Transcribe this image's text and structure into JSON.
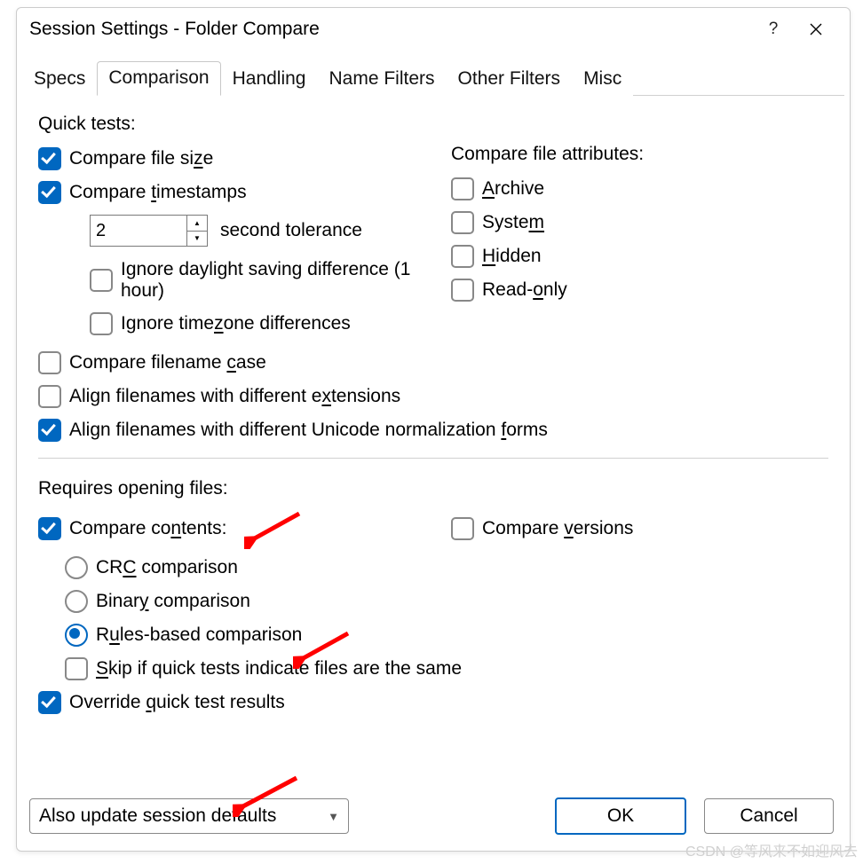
{
  "window": {
    "title": "Session Settings - Folder Compare",
    "help_label": "?",
    "close_label": "×"
  },
  "tabs": {
    "specs": "Specs",
    "comparison": "Comparison",
    "handling": "Handling",
    "name_filters": "Name Filters",
    "other_filters": "Other Filters",
    "misc": "Misc"
  },
  "quick_tests": {
    "heading": "Quick tests:",
    "compare_file_size": {
      "pre": "Compare file si",
      "u": "z",
      "post": "e",
      "checked": true
    },
    "compare_timestamps": {
      "pre": "Compare ",
      "u": "t",
      "post": "imestamps",
      "checked": true
    },
    "tolerance_value": "2",
    "tolerance_suffix": "second tolerance",
    "ignore_dst": {
      "pre": "Ignore daylight saving difference (1 hour)",
      "u": "",
      "post": "",
      "checked": false
    },
    "ignore_tz": {
      "pre": "Ignore time",
      "u": "z",
      "post": "one differences",
      "checked": false
    },
    "compare_case": {
      "pre": "Compare filename ",
      "u": "c",
      "post": "ase",
      "checked": false
    },
    "align_ext": {
      "pre": "Align filenames with different e",
      "u": "x",
      "post": "tensions",
      "checked": false
    },
    "align_unicode": {
      "pre": "Align filenames with different Unicode normalization ",
      "u": "f",
      "post": "orms",
      "checked": true
    }
  },
  "attributes": {
    "heading": "Compare file attributes:",
    "archive": {
      "pre": "",
      "u": "A",
      "post": "rchive",
      "checked": false
    },
    "system": {
      "pre": "Syste",
      "u": "m",
      "post": "",
      "checked": false
    },
    "hidden": {
      "pre": "",
      "u": "H",
      "post": "idden",
      "checked": false
    },
    "readonly": {
      "pre": "Read-",
      "u": "o",
      "post": "nly",
      "checked": false
    }
  },
  "requires": {
    "heading": "Requires opening files:",
    "compare_contents": {
      "pre": "Compare co",
      "u": "n",
      "post": "tents:",
      "checked": true
    },
    "compare_versions": {
      "pre": "Compare ",
      "u": "v",
      "post": "ersions",
      "checked": false
    },
    "crc": {
      "pre": "CR",
      "u": "C",
      "post": " comparison",
      "checked": false
    },
    "binary": {
      "pre": "Binar",
      "u": "y",
      "post": " comparison",
      "checked": false
    },
    "rules": {
      "pre": "R",
      "u": "u",
      "post": "les-based comparison",
      "checked": true
    },
    "skip": {
      "pre": "",
      "u": "S",
      "post": "kip if quick tests indicate files are the same",
      "checked": false
    },
    "override": {
      "pre": "Override ",
      "u": "q",
      "post": "uick test results",
      "checked": true
    }
  },
  "footer": {
    "combo_value": "Also update session defaults",
    "ok": "OK",
    "cancel": "Cancel"
  },
  "watermark": "CSDN @等风来不如迎风去"
}
